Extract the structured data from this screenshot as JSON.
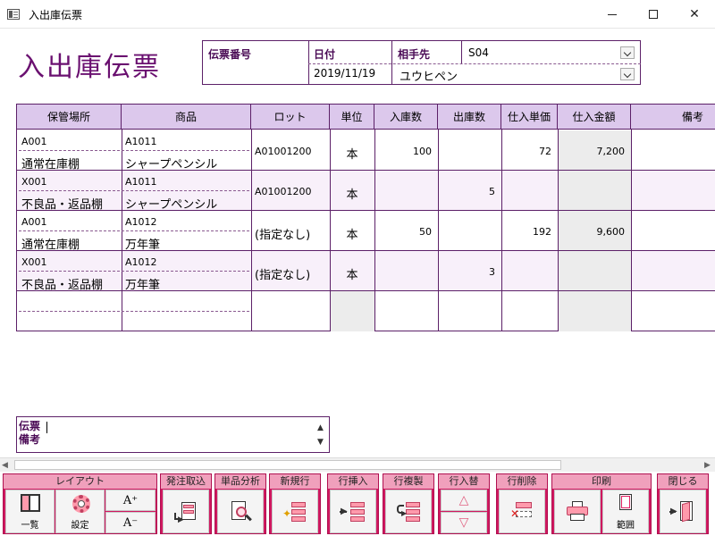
{
  "window": {
    "title": "入出庫伝票"
  },
  "page_title": "入出庫伝票",
  "header": {
    "slip_number_label": "伝票番号",
    "slip_number_value": "",
    "date_label": "日付",
    "date_value": "2019/11/19",
    "partner_label": "相手先",
    "partner_code": "S04",
    "partner_name": "ユウヒペン"
  },
  "grid": {
    "columns": [
      "保管場所",
      "商品",
      "ロット",
      "単位",
      "入庫数",
      "出庫数",
      "仕入単価",
      "仕入金額",
      "備考"
    ],
    "rows": [
      {
        "location_code": "A001",
        "location_name": "通常在庫棚",
        "item_code": "A1011",
        "item_name": "シャープペンシル",
        "lot": "A01001200",
        "unit": "本",
        "in_qty": "100",
        "out_qty": "",
        "unit_price": "72",
        "amount": "7,200",
        "note": ""
      },
      {
        "location_code": "X001",
        "location_name": "不良品・返品棚",
        "item_code": "A1011",
        "item_name": "シャープペンシル",
        "lot": "A01001200",
        "unit": "本",
        "in_qty": "",
        "out_qty": "5",
        "unit_price": "",
        "amount": "",
        "note": ""
      },
      {
        "location_code": "A001",
        "location_name": "通常在庫棚",
        "item_code": "A1012",
        "item_name": "万年筆",
        "lot": "(指定なし)",
        "unit": "本",
        "in_qty": "50",
        "out_qty": "",
        "unit_price": "192",
        "amount": "9,600",
        "note": ""
      },
      {
        "location_code": "X001",
        "location_name": "不良品・返品棚",
        "item_code": "A1012",
        "item_name": "万年筆",
        "lot": "(指定なし)",
        "unit": "本",
        "in_qty": "",
        "out_qty": "3",
        "unit_price": "",
        "amount": "",
        "note": ""
      },
      {
        "location_code": "",
        "location_name": "",
        "item_code": "",
        "item_name": "",
        "lot": "",
        "unit": "",
        "in_qty": "",
        "out_qty": "",
        "unit_price": "",
        "amount": "",
        "note": ""
      }
    ]
  },
  "memo": {
    "label_line1": "伝票",
    "label_line2": "備考",
    "value": ""
  },
  "toolbar": {
    "groups": {
      "layout": "レイアウト",
      "order_import": "発注取込",
      "item_analysis": "単品分析",
      "new_row": "新規行",
      "insert_row": "行挿入",
      "copy_row": "行複製",
      "swap_row": "行入替",
      "delete_row": "行削除",
      "print": "印刷",
      "close": "閉じる"
    },
    "buttons": {
      "list": "一覧",
      "settings": "設定",
      "font_up": "A⁺",
      "font_down": "A⁻",
      "range": "範囲"
    }
  },
  "colors": {
    "accent_purple": "#6a1070",
    "header_lavender": "#dcc8ec",
    "row_alt": "#f8f0fa",
    "shaded_cell": "#ececec",
    "toolbar_magenta": "#d01860",
    "toolbar_label_pink": "#f0a0bc"
  }
}
